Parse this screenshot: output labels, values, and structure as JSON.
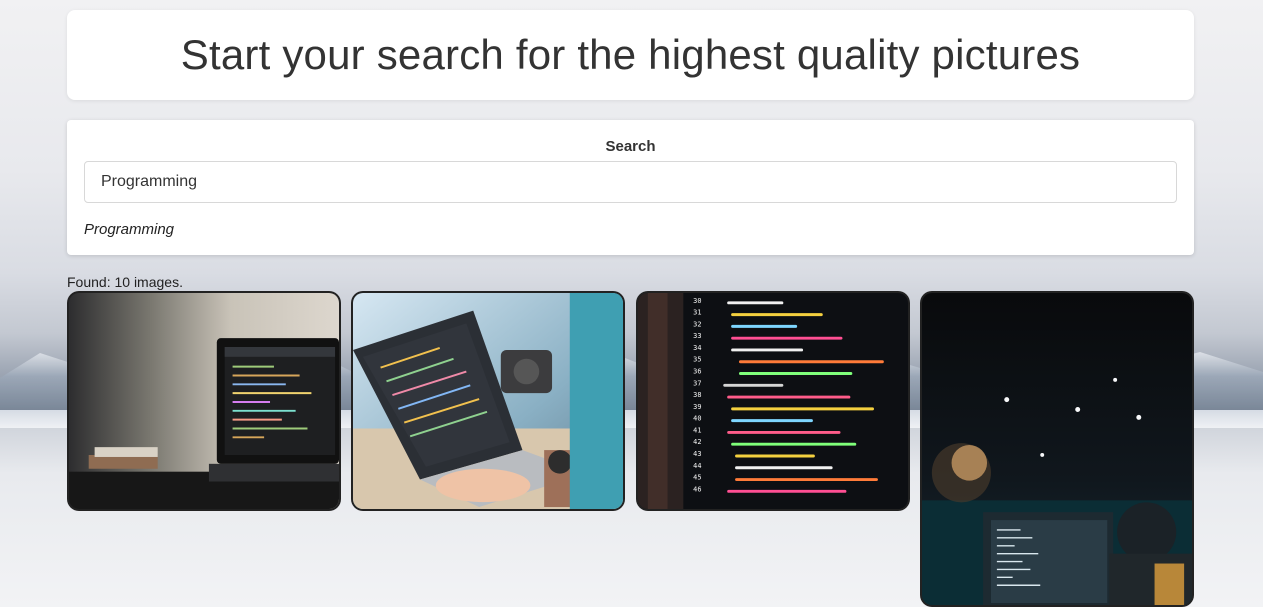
{
  "header": {
    "title": "Start your search for the highest quality pictures"
  },
  "search": {
    "label": "Search",
    "value": "Programming",
    "echo": "Programming"
  },
  "results": {
    "found_text": "Found: 10 images."
  },
  "gallery": {
    "images": [
      {
        "subject": "laptop-on-desk-with-code",
        "icon": "photo-icon"
      },
      {
        "subject": "person-typing-on-laptop",
        "icon": "photo-icon"
      },
      {
        "subject": "code-on-dark-monitor",
        "icon": "photo-icon"
      },
      {
        "subject": "developer-at-monitors",
        "icon": "photo-icon"
      }
    ]
  },
  "colors": {
    "card_background": "#ffffff",
    "text_primary": "#333333",
    "image_border": "#222222"
  }
}
